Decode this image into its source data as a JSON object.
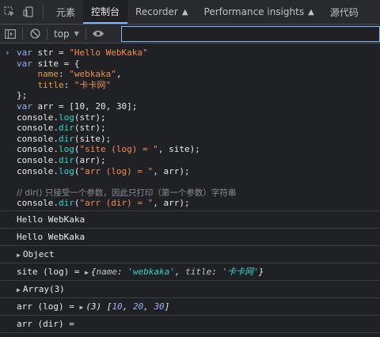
{
  "tabs": [
    {
      "label": "元素"
    },
    {
      "label": "控制台"
    },
    {
      "label": "Recorder"
    },
    {
      "label": "Performance insights"
    },
    {
      "label": "源代码"
    }
  ],
  "toolbar": {
    "context": "top",
    "filter_value": ""
  },
  "code": {
    "l1": {
      "a": "var",
      "b": " str = ",
      "c": "\"Hello WebKaka\""
    },
    "l2": {
      "a": "var",
      "b": " site = {"
    },
    "l3": {
      "pad": "    ",
      "key": "name",
      "colon": ": ",
      "val": "\"webkaka\"",
      "end": ","
    },
    "l4": {
      "pad": "    ",
      "key": "title",
      "colon": ": ",
      "val": "\"卡卡网\""
    },
    "l5": {
      "text": "};"
    },
    "l6": {
      "a": "var",
      "b": " arr = [10, 20, 30];"
    },
    "l7": {
      "a": "console.",
      "fn": "log",
      "b": "(str);"
    },
    "l8": {
      "a": "console.",
      "fn": "dir",
      "b": "(str);"
    },
    "l9": {
      "a": "console.",
      "fn": "dir",
      "b": "(site);"
    },
    "l10": {
      "a": "console.",
      "fn": "log",
      "b": "(",
      "s": "\"site (log) = \"",
      "c": ", site);"
    },
    "l11": {
      "a": "console.",
      "fn": "dir",
      "b": "(arr);"
    },
    "l12": {
      "a": "console.",
      "fn": "log",
      "b": "(",
      "s": "\"arr (log) = \"",
      "c": ", arr);"
    },
    "l13": {
      "text": "// dir() 只接受一个参数，因此只打印（第一个参数）字符串"
    },
    "l14": {
      "a": "console.",
      "fn": "dir",
      "b": "(",
      "s": "\"arr (dir) = \"",
      "c": ", arr);"
    }
  },
  "output": {
    "o1": "Hello WebKaka",
    "o2": "Hello WebKaka",
    "o3": "Object",
    "o4": {
      "prefix": "site (log) = ",
      "open": "{",
      "k1": "name",
      "v1": "'webkaka'",
      "sep": ", ",
      "k2": "title",
      "v2": "'卡卡网'",
      "close": "}"
    },
    "o5": "Array(3)",
    "o6": {
      "prefix": "arr (log) = ",
      "count": "(3) [",
      "n1": "10",
      "n2": "20",
      "n3": "30",
      "close": "]"
    },
    "o7": "arr (dir) ="
  }
}
